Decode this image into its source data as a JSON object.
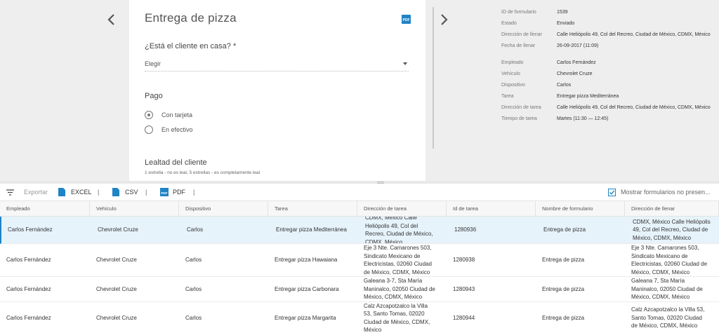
{
  "form": {
    "title": "Entrega de pizza",
    "pdf_icon": "PDF",
    "q_home": "¿Está el cliente en casa? *",
    "select_value": "Elegir",
    "q_payment": "Pago",
    "payment_options": [
      "Con tarjeta",
      "En efectivo"
    ],
    "payment_selected": "Con tarjeta",
    "q_loyalty": "Lealtad del cliente",
    "loyalty_hint": "1 estrella - no es leal, 5 estrellas - es completamente leal"
  },
  "details": [
    {
      "label": "ID de formulario",
      "value": "1539"
    },
    {
      "label": "Estado",
      "value": "Enviado"
    },
    {
      "label": "Dirección de llenar",
      "value": "Calle Heliópolis 49, Col del Recreo, Ciudad de México, CDMX, México"
    },
    {
      "label": "Fecha de llenar",
      "value": "26-09-2017 (11:09)"
    },
    {
      "label": "Empleado",
      "value": "Carlos Fernández"
    },
    {
      "label": "Vehículo",
      "value": "Chevrolet Cruze"
    },
    {
      "label": "Dispositivo",
      "value": "Carlos"
    },
    {
      "label": "Tarea",
      "value": "Entregar pizza Mediterránea"
    },
    {
      "label": "Dirección de tarea",
      "value": "Calle Heliópolis 49, Col del Recreo, Ciudad de México, CDMX, México"
    },
    {
      "label": "Tiempo de tarea",
      "value": "Martes (11:30 — 12:45)"
    }
  ],
  "toolbar": {
    "export_label": "Exportar",
    "excel_label": "EXCEL",
    "csv_label": "CSV",
    "pdf_label": "PDF",
    "pdf_icon": "PDF",
    "separator": "|",
    "show_hidden_label": "Mostrar formularios no presen...",
    "show_hidden_checked": true
  },
  "table": {
    "columns": [
      "Empleado",
      "Vehículo",
      "Dispositivo",
      "Tarea",
      "Dirección de tarea",
      "Id de tarea",
      "Nombre de formulario",
      "Dirección de llenar"
    ],
    "rows": [
      [
        "Carlos Fernández",
        "Chevrolet Cruze",
        "Carlos",
        "Entregar pizza Mediterránea",
        "CDMX, México Calle Heliópolis 49, Col del Recreo, Ciudad de México, CDMX, México",
        "1280936",
        "Entrega de pizza",
        "CDMX, México Calle Heliópolis 49, Col del Recreo, Ciudad de México, CDMX, México"
      ],
      [
        "Carlos Fernández",
        "Chevrolet Cruze",
        "Carlos",
        "Entregar pizza Hawaiana",
        "Eje 3 Nte. Camarones 503, Sindicato Mexicano de Electricistas, 02060 Ciudad de México, CDMX, México",
        "1280938",
        "Entrega de pizza",
        "Eje 3 Nte. Camarones 503, Sindicato Mexicano de Electricistas, 02060 Ciudad de México, CDMX, México"
      ],
      [
        "Carlos Fernández",
        "Chevrolet Cruze",
        "Carlos",
        "Entregar pizza Carbonara",
        "Galeana 3-7, Sta María Maninalco, 02050 Ciudad de México, CDMX, México",
        "1280943",
        "Entrega de pizza",
        "Galeana 7, Sta María Maninalco, 02050 Ciudad de México, CDMX, México"
      ],
      [
        "Carlos Fernández",
        "Chevrolet Cruze",
        "Carlos",
        "Entregar pizza Margarita",
        "Calz Azcapotzalco la Villa 53, Santo Tomas, 02020 Ciudad de México, CDMX, México",
        "1280944",
        "Entrega de pizza",
        "Calz Azcapotzalco la Villa 53, Santo Tomas, 02020 Ciudad de México, CDMX, México"
      ]
    ],
    "selected_row": 0
  },
  "colors": {
    "accent": "#1f83c6",
    "selected_row": "#e6f3fb",
    "background": "#eeeeee"
  }
}
